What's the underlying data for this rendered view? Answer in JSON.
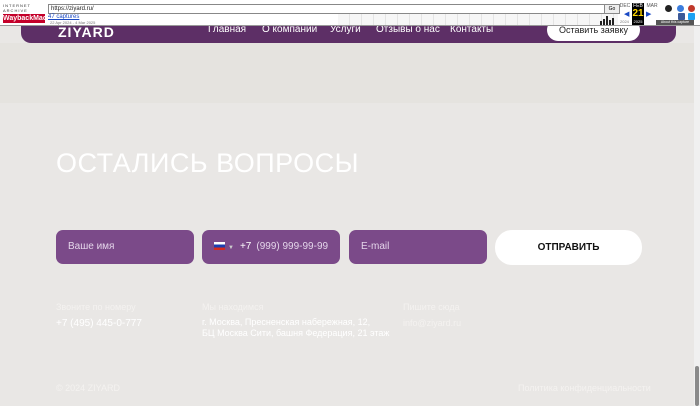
{
  "wayback": {
    "logo_top": "INTERNET ARCHIVE",
    "logo_main": "WaybackMachine",
    "url": "https://ziyard.ru/",
    "go": "Go",
    "captures": "47 captures",
    "range": "22 Apr 2024 - 4 Mar 2025",
    "prev_month": "DEC",
    "cur_month": "FEB",
    "next_month": "MAR",
    "day": "21",
    "cur_year": "2025",
    "prev_year": "2024",
    "next_year": "2026",
    "about": "About this capture"
  },
  "nav": {
    "brand": "ZIYARD",
    "links": [
      "Главная",
      "О компании",
      "Услуги",
      "Отзывы о нас",
      "Контакты"
    ],
    "cta": "Оставить заявку"
  },
  "form": {
    "title": "ОСТАЛИСЬ ВОПРОСЫ",
    "name_placeholder": "Ваше имя",
    "phone_prefix": "+7",
    "phone_placeholder": "(999) 999-99-99",
    "email_placeholder": "E-mail",
    "submit": "ОТПРАВИТЬ"
  },
  "contacts": {
    "call_label": "Звоните по номеру",
    "phone": "+7 (495) 445-0-777",
    "address_label": "Мы находимся",
    "address_line1": "г. Москва, Пресненская набережная, 12,",
    "address_line2": "БЦ Москва Сити, башня Федерация, 21 этаж",
    "write_label": "Пишите сюда",
    "email": "info@ziyard.ru"
  },
  "footer": {
    "copyright": "© 2024 ZIYARD",
    "privacy": "Политика конфиденциальности"
  }
}
